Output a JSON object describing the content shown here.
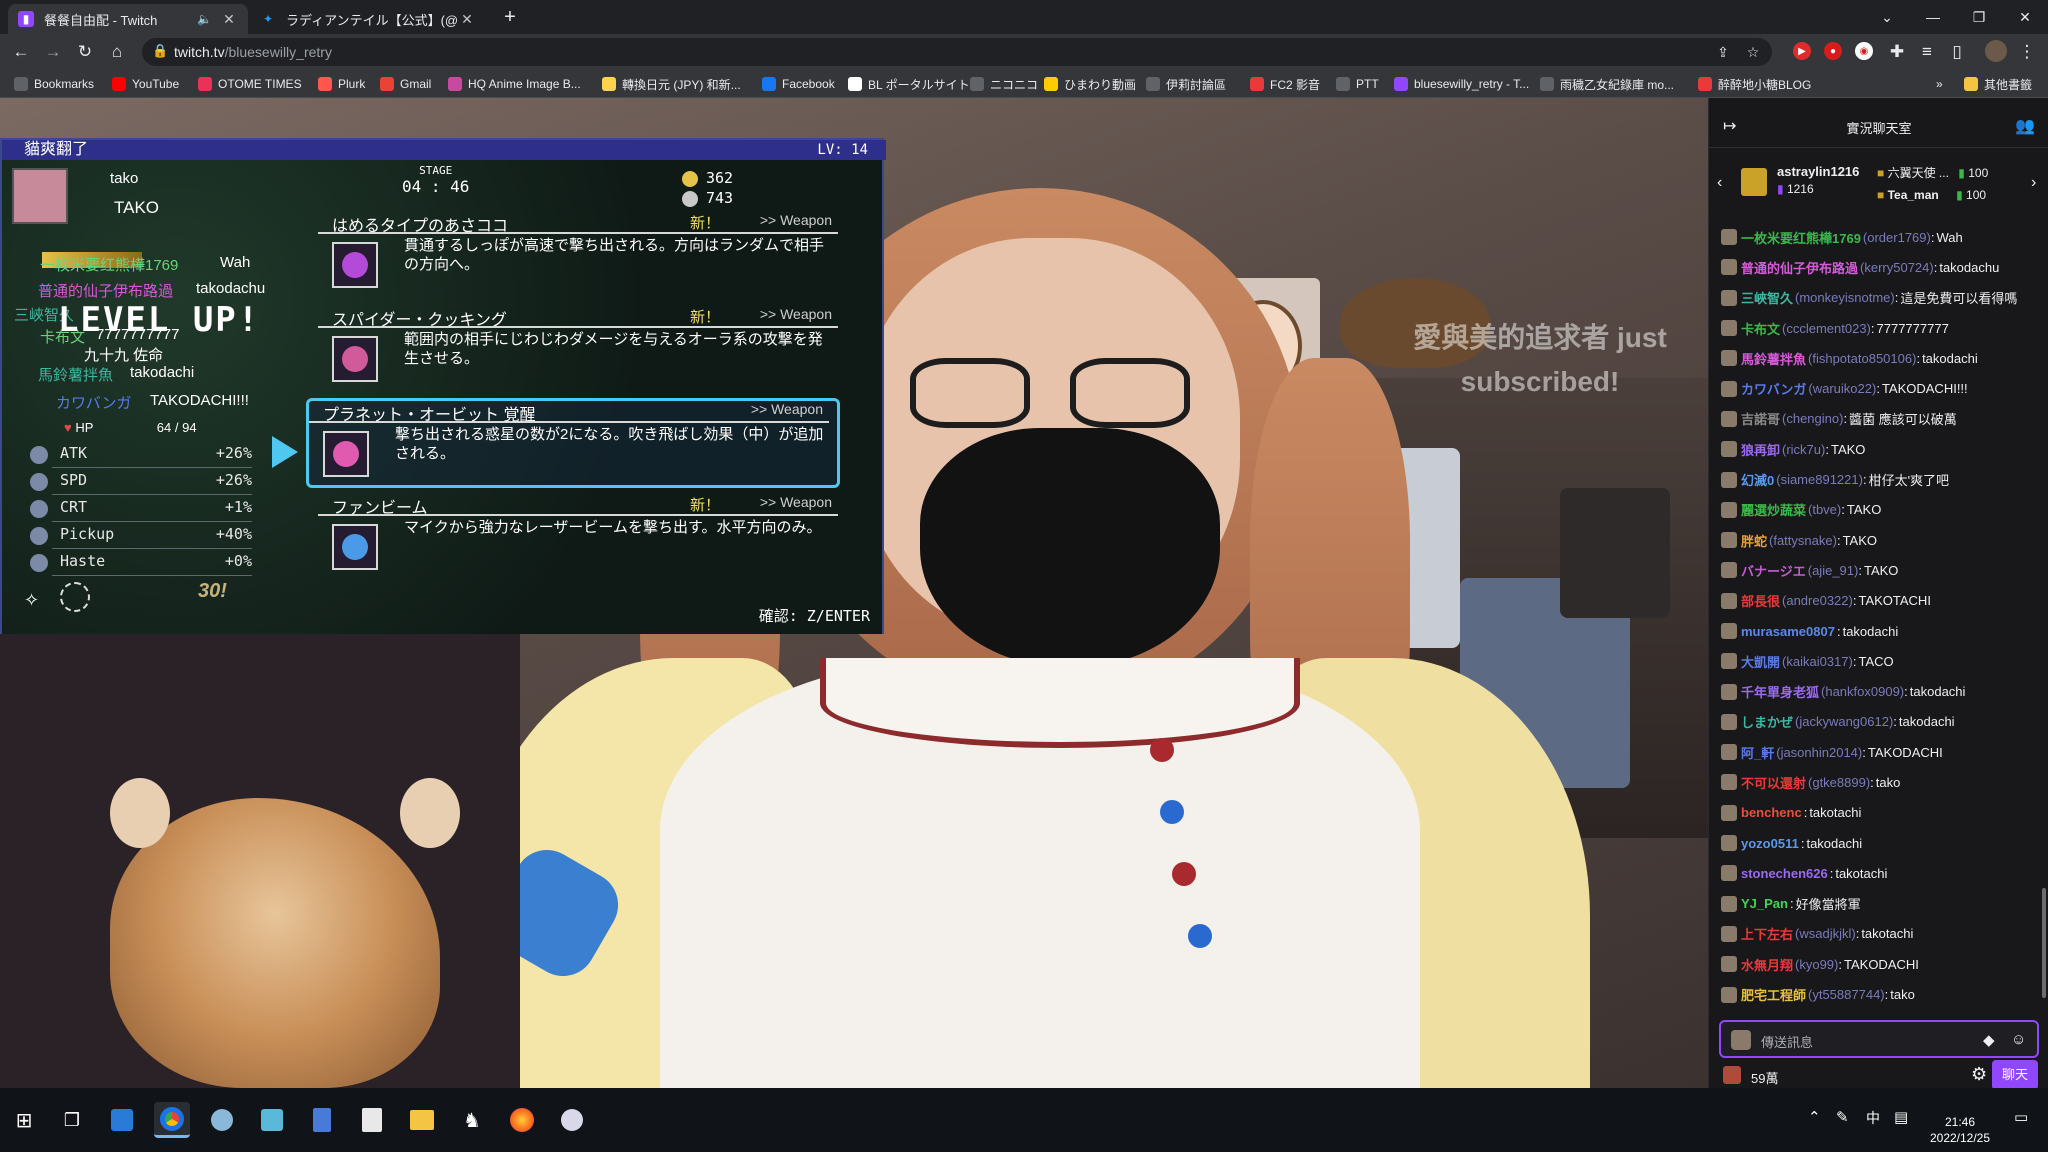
{
  "browser": {
    "tabs": [
      {
        "title": "餐餐自由配 - Twitch",
        "active": true,
        "audio": true
      },
      {
        "title": "ラディアンテイル【公式】(@RT_x_inf",
        "active": false,
        "audio": false
      }
    ],
    "url_host": "twitch.tv",
    "url_path": "/bluesewilly_retry",
    "bookmarks": [
      {
        "label": "Bookmarks",
        "icon": "grid-icon",
        "color": "#5f6368"
      },
      {
        "label": "YouTube",
        "icon": "youtube-icon",
        "color": "#ff0000"
      },
      {
        "label": "OTOME TIMES",
        "icon": "otome-icon",
        "color": "#e8325a"
      },
      {
        "label": "Plurk",
        "icon": "plurk-icon",
        "color": "#ff574d"
      },
      {
        "label": "Gmail",
        "icon": "gmail-icon",
        "color": "#ea4335"
      },
      {
        "label": "HQ Anime Image B...",
        "icon": "anime-icon",
        "color": "#c84aa0"
      },
      {
        "label": "轉換日元 (JPY) 和新...",
        "icon": "currency-icon",
        "color": "#ffd34d"
      },
      {
        "label": "Facebook",
        "icon": "facebook-icon",
        "color": "#1877f2"
      },
      {
        "label": "BL ポータルサイト",
        "icon": "bl-icon",
        "color": "#ffffff"
      },
      {
        "label": "ニコニコ",
        "icon": "niconico-icon",
        "color": "#5f6368"
      },
      {
        "label": "ひまわり動画",
        "icon": "himawari-icon",
        "color": "#ffcc00"
      },
      {
        "label": "伊莉討論區",
        "icon": "eyny-icon",
        "color": "#5f6368"
      },
      {
        "label": "FC2 影音",
        "icon": "fc2-icon",
        "color": "#e83a3a"
      },
      {
        "label": "PTT",
        "icon": "ptt-icon",
        "color": "#5f6368"
      },
      {
        "label": "bluesewilly_retry - T...",
        "icon": "twitch-icon",
        "color": "#9147ff"
      },
      {
        "label": "雨穢乙女紀錄庫 mo...",
        "icon": "globe-icon",
        "color": "#5f6368"
      },
      {
        "label": "醉醉地小糖BLOG",
        "icon": "blog-icon",
        "color": "#e83a3a"
      }
    ],
    "more_bookmarks_label": "其他書籤"
  },
  "game": {
    "title_name": "貓爽翻了",
    "level": "LV: 14",
    "player": "tako",
    "player2": "TAKO",
    "stage_label": "STAGE",
    "stage_time": "04 : 46",
    "coins": "362",
    "kills": "743",
    "levelup_text": "LEVEL UP!",
    "overlay_names": [
      {
        "text": "一枚米要红熊樺1769",
        "color": "#6ad47a"
      },
      {
        "text": "Wah",
        "color": "#ffffff"
      },
      {
        "text": "普通的仙子伊布路過",
        "color": "#d55ad8"
      },
      {
        "text": "takodachu",
        "color": "#ffffff"
      },
      {
        "text": "三峽智久",
        "color": "#3bb8a0"
      },
      {
        "text": "卡布文",
        "color": "#6ad47a"
      },
      {
        "text": "7777777777",
        "color": "#ffffff"
      },
      {
        "text": "九十九 佐命",
        "color": "#ffffff"
      },
      {
        "text": "馬鈴薯拌魚",
        "color": "#3bb8a0"
      },
      {
        "text": "takodachi",
        "color": "#ffffff"
      },
      {
        "text": "カワバンガ",
        "color": "#5a7ae8"
      },
      {
        "text": "TAKODACHI!!!",
        "color": "#ffffff"
      }
    ],
    "hp_label": "HP",
    "hp_value": "64 / 94",
    "stats": [
      {
        "name": "ATK",
        "value": "+26%"
      },
      {
        "name": "SPD",
        "value": "+26%"
      },
      {
        "name": "CRT",
        "value": "+1%"
      },
      {
        "name": "Pickup",
        "value": "+40%"
      },
      {
        "name": "Haste",
        "value": "+0%"
      }
    ],
    "choices": [
      {
        "name": "はめるタイプのあさココ",
        "new": "新！",
        "kind": ">> Weapon",
        "desc": "貫通するしっぽが高速で撃ち出される。方向はランダムで相手の方向へ。",
        "icon_color": "#b44ad8"
      },
      {
        "name": "スパイダー・クッキング",
        "new": "新！",
        "kind": ">> Weapon",
        "desc": "範囲内の相手にじわじわダメージを与えるオーラ系の攻撃を発生させる。",
        "icon_color": "#d05a9a"
      },
      {
        "name": "プラネット・オービット 覚醒",
        "new": "",
        "kind": ">> Weapon",
        "desc": "撃ち出される惑星の数が2になる。吹き飛ばし効果（中）が追加される。",
        "icon_color": "#e05ab0"
      },
      {
        "name": "ファンビーム",
        "new": "新！",
        "kind": ">> Weapon",
        "desc": "マイクから強力なレーザービームを撃ち出す。水平方向のみ。",
        "icon_color": "#4a9ae8"
      }
    ],
    "confirm_hint": "確認: Z/ENTER",
    "combo": "30!"
  },
  "stream_overlay": {
    "sub_line1": "愛與美的追求者 just",
    "sub_line2": "subscribed!"
  },
  "chat": {
    "header_title": "實況聊天室",
    "gift_top_user": "astraylin1216",
    "gift_top_count": "1216",
    "gift_right": [
      {
        "name": "六翼天使 ...",
        "count": "100"
      },
      {
        "name": "Tea_man",
        "count": "100"
      }
    ],
    "messages": [
      {
        "user": "一枚米要红熊樺1769",
        "login": "(order1769)",
        "text": "Wah",
        "color": "#3bb84a"
      },
      {
        "user": "普通的仙子伊布路過",
        "login": "(kerry50724)",
        "text": "takodachu",
        "color": "#d55ad8"
      },
      {
        "user": "三峽智久",
        "login": "(monkeyisnotme)",
        "text": "這是免費可以看得嗎",
        "color": "#3bb8a0"
      },
      {
        "user": "卡布文",
        "login": "(ccclement023)",
        "text": "7777777777",
        "color": "#3bb84a"
      },
      {
        "user": "馬鈴薯拌魚",
        "login": "(fishpotato850106)",
        "text": "takodachi",
        "color": "#d55ad8"
      },
      {
        "user": "カワバンガ",
        "login": "(waruiko22)",
        "text": "TAKODACHI!!!",
        "color": "#5a7ae8"
      },
      {
        "user": "吉諾哥",
        "login": "(chengino)",
        "text": "醬菌 應該可以破萬",
        "color": "#8a8a8a"
      },
      {
        "user": "狼再卸",
        "login": "(rick7u)",
        "text": "TAKO",
        "color": "#9a6af0"
      },
      {
        "user": "幻滅0",
        "login": "(siame891221)",
        "text": "柑仔太'爽了吧",
        "color": "#5a9ae8"
      },
      {
        "user": "麗選炒蔬菜",
        "login": "(tbve)",
        "text": "TAKO",
        "color": "#3bb84a"
      },
      {
        "user": "胖蛇",
        "login": "(fattysnake)",
        "text": "TAKO",
        "color": "#e8a03a"
      },
      {
        "user": "バナージエ",
        "login": "(ajie_91)",
        "text": "TAKO",
        "color": "#c85ad8"
      },
      {
        "user": "部長很",
        "login": "(andre0322)",
        "text": "TAKOTACHI",
        "color": "#e83a3a"
      },
      {
        "user": "murasame0807",
        "login": "",
        "text": "takodachi",
        "color": "#5a8ae8"
      },
      {
        "user": "大凱開",
        "login": "(kaikai0317)",
        "text": "TACO",
        "color": "#5a7ae8"
      },
      {
        "user": "千年單身老狐",
        "login": "(hankfox0909)",
        "text": "takodachi",
        "color": "#9a6af0"
      },
      {
        "user": "しまかぜ",
        "login": "(jackywang0612)",
        "text": "takodachi",
        "color": "#3bb8a0"
      },
      {
        "user": "阿_軒",
        "login": "(jasonhin2014)",
        "text": "TAKODACHI",
        "color": "#5a7ae8"
      },
      {
        "user": "不可以還射",
        "login": "(gtke8899)",
        "text": "tako",
        "color": "#e83a3a"
      },
      {
        "user": "benchenc",
        "login": "",
        "text": "takotachi",
        "color": "#e8503a"
      },
      {
        "user": "yozo0511",
        "login": "",
        "text": "takodachi",
        "color": "#5a9ae8"
      },
      {
        "user": "stonechen626",
        "login": "",
        "text": "takotachi",
        "color": "#9a6af0"
      },
      {
        "user": "YJ_Pan",
        "login": "",
        "text": "好像當將軍",
        "color": "#3bd84a"
      },
      {
        "user": "上下左右",
        "login": "(wsadjkjkl)",
        "text": "takotachi",
        "color": "#e83a3a"
      },
      {
        "user": "水無月翔",
        "login": "(kyo99)",
        "text": "TAKODACHI",
        "color": "#e83a3a"
      },
      {
        "user": "肥宅工程師",
        "login": "(yt55887744)",
        "text": "tako",
        "color": "#e8c03a"
      }
    ],
    "input_placeholder": "傳送訊息",
    "points": "59萬",
    "send_label": "聊天"
  },
  "taskbar": {
    "time": "21:46",
    "date": "2022/12/25",
    "ime": "中"
  }
}
